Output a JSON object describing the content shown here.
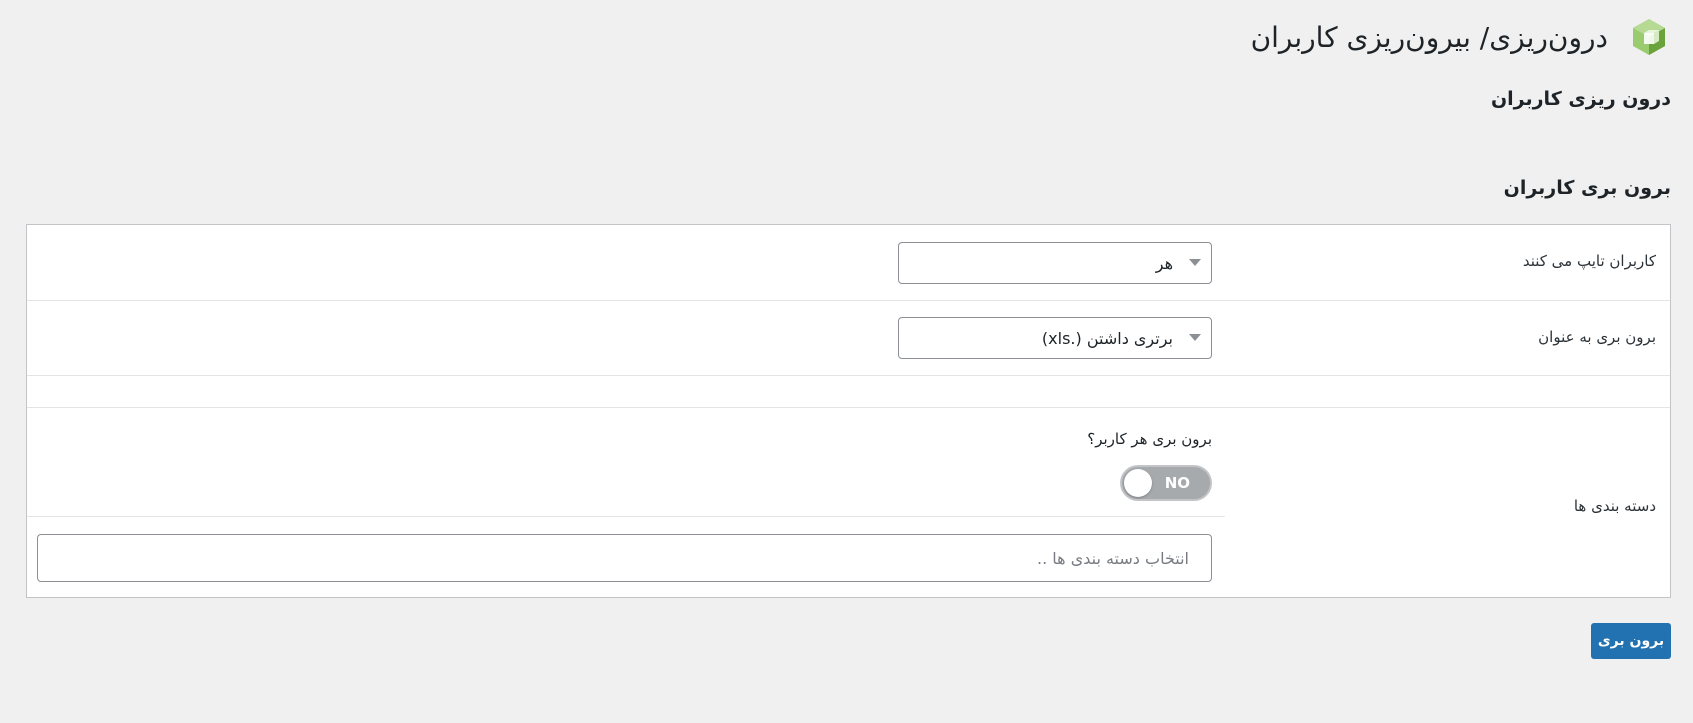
{
  "header": {
    "title": "درون‌ریزی/ بیرون‌ریزی کاربران",
    "logo_icon": "green-cube-icon",
    "logo_color": "#7ab648"
  },
  "import_section": {
    "title": "درون ریزی کاربران"
  },
  "export_section": {
    "title": "برون بری کاربران",
    "user_types": {
      "label": "کاربران تایپ می کنند",
      "selected": "هر"
    },
    "export_as": {
      "label": "برون بری به عنوان",
      "selected": "برتری داشتن (.xls)"
    },
    "categories": {
      "label": "دسته بندی ها",
      "each_user_label": "برون بری هر کاربر؟",
      "toggle_text": "NO",
      "toggle_on": false,
      "input_placeholder": "انتخاب دسته بندی ها .."
    },
    "export_button": "برون بری"
  },
  "colors": {
    "accent": "#2271b1",
    "background": "#f0f0f1",
    "toggle_off": "#a7aaad"
  }
}
